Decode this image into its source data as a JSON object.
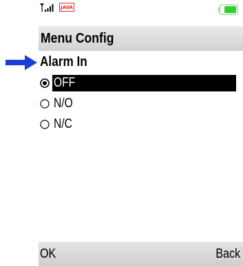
{
  "colors": {
    "pointer_arrow": "#1c3fd6",
    "selection_bg": "#000000",
    "selection_fg": "#ffffff",
    "java_badge": "#e02a2a",
    "battery_fill": "#33cc33"
  },
  "status_bar": {
    "signal_icon": "signal-strength-icon",
    "java_label": "JAVA",
    "battery_icon": "battery-icon"
  },
  "screen": {
    "title": "Menu Config",
    "section_heading": "Alarm In",
    "options": [
      {
        "label": "OFF",
        "selected": true
      },
      {
        "label": "N/O",
        "selected": false
      },
      {
        "label": "N/C",
        "selected": false
      }
    ]
  },
  "softkeys": {
    "left": "OK",
    "right": "Back"
  }
}
